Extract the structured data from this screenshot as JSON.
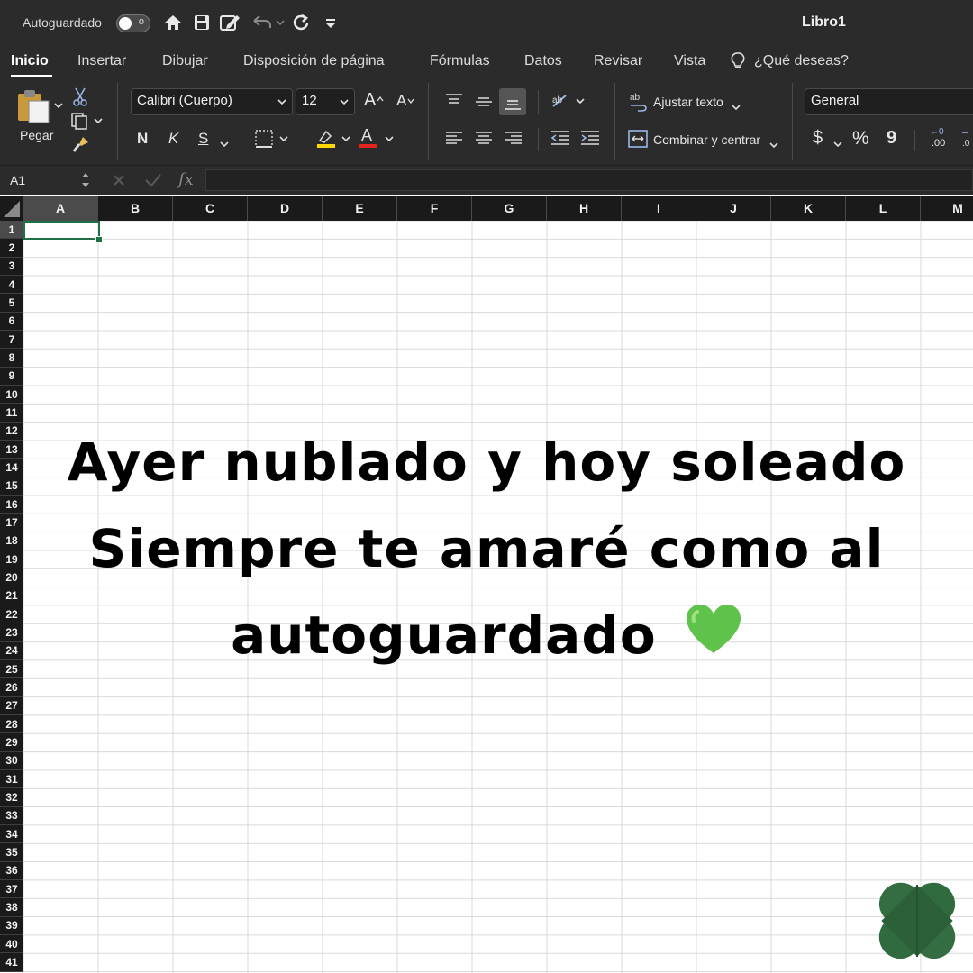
{
  "titlebar": {
    "autosave_label": "Autoguardado",
    "toggle_state": "o",
    "window_title": "Libro1"
  },
  "tabs": [
    "Inicio",
    "Insertar",
    "Dibujar",
    "Disposición de página",
    "Fórmulas",
    "Datos",
    "Revisar",
    "Vista",
    "¿Qué deseas?"
  ],
  "ribbon": {
    "paste_label": "Pegar",
    "font_name": "Calibri (Cuerpo)",
    "font_size": "12",
    "bold": "N",
    "italic": "K",
    "underline": "S",
    "wrap_text": "Ajustar texto",
    "merge_center": "Combinar y centrar",
    "number_format": "General",
    "currency": "$",
    "percent": "%",
    "comma": "9",
    "inc_decimal": ".00",
    "inc_decimal_top": "←0",
    "font_grow": "A",
    "font_shrink": "A",
    "highlight_color": "#ffd800",
    "font_color": "#e8231e"
  },
  "formula_bar": {
    "cell_ref": "A1",
    "fx": "fx",
    "content": ""
  },
  "sheet": {
    "columns": [
      "A",
      "B",
      "C",
      "D",
      "E",
      "F",
      "G",
      "H",
      "I",
      "J",
      "K",
      "L",
      "M"
    ],
    "rows": [
      "1",
      "2",
      "3",
      "4",
      "5",
      "6",
      "7",
      "8",
      "9",
      "10",
      "11",
      "12",
      "13",
      "14",
      "15",
      "16",
      "17",
      "18",
      "19",
      "20",
      "21",
      "22",
      "23",
      "24",
      "25",
      "26",
      "27",
      "28",
      "29",
      "30",
      "31",
      "32",
      "33",
      "34",
      "35",
      "36",
      "37",
      "38",
      "39",
      "40",
      "41"
    ],
    "selected_cell": "A1"
  },
  "overlay": {
    "line1": "Ayer nublado y hoy soleado",
    "line2": "Siempre te amaré como al",
    "line3": "autoguardado",
    "emoji": "green-heart"
  },
  "colors": {
    "chrome": "#2b2b2b",
    "header": "#1a1a1a",
    "selection": "#1e7145",
    "logo": "#2f6b3f"
  }
}
